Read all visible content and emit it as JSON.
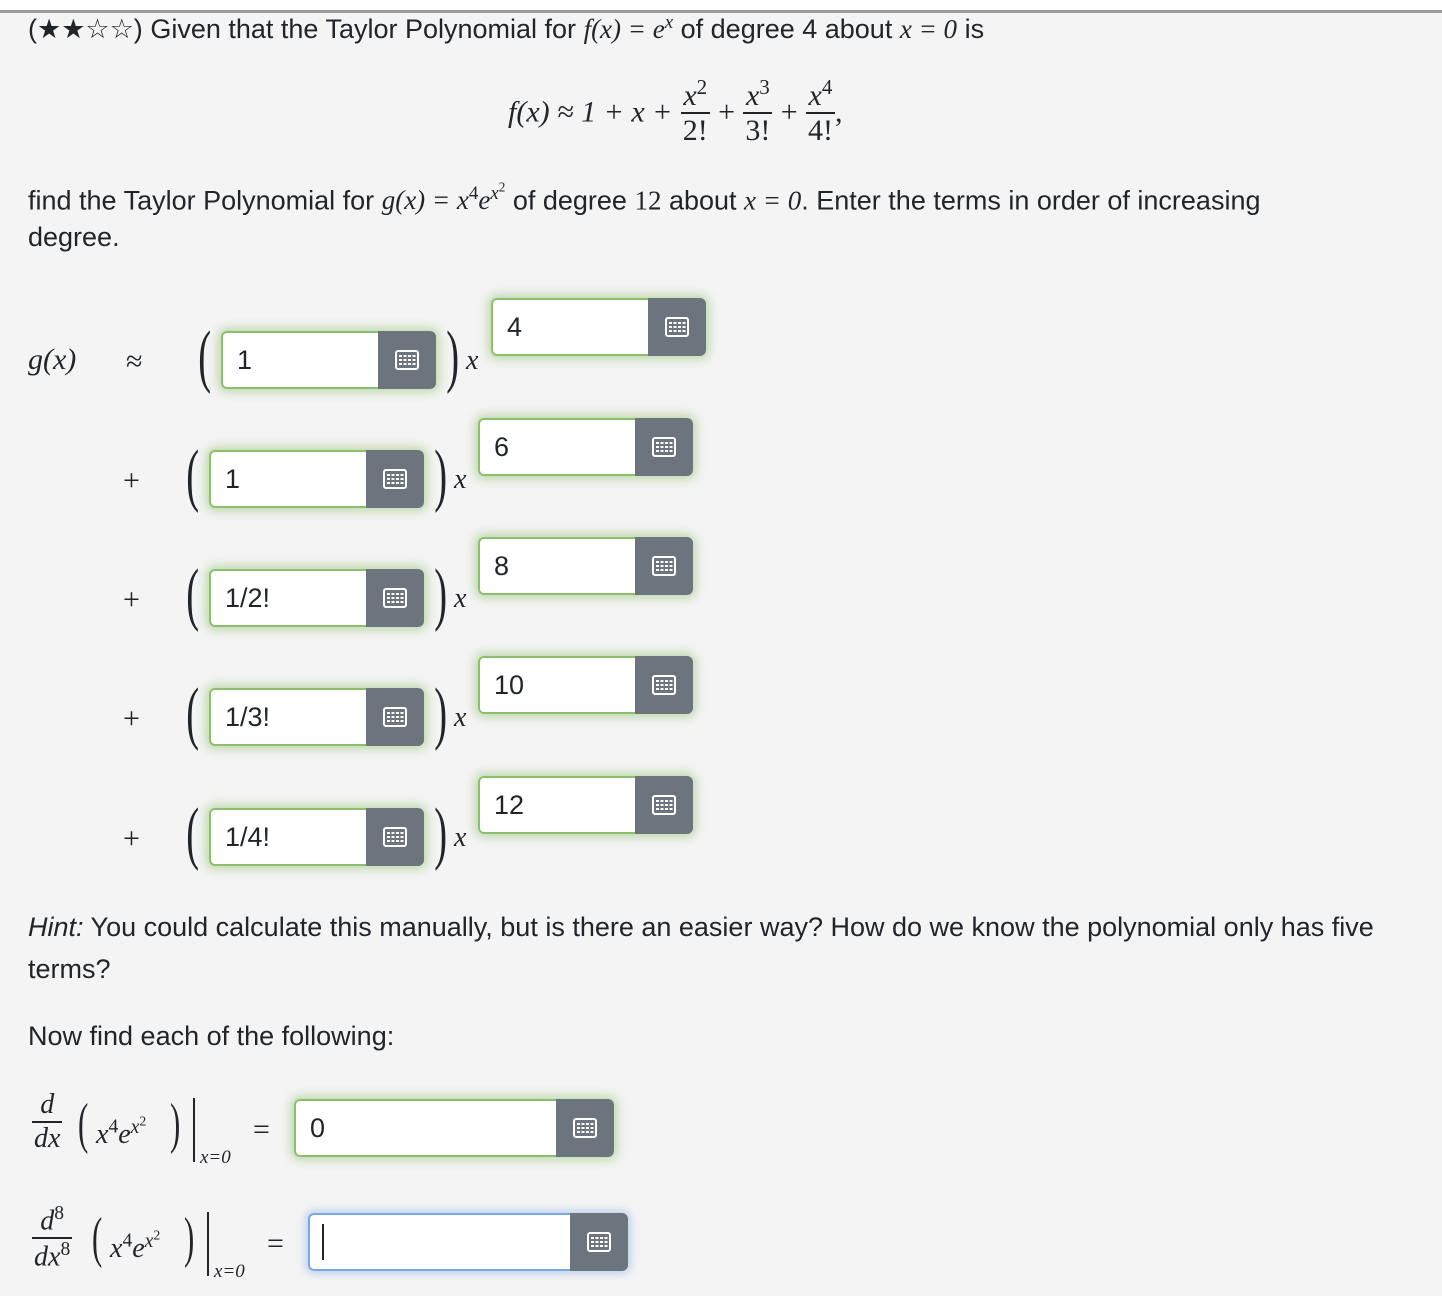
{
  "question": {
    "stars": "(★★☆☆)",
    "intro_text": "Given that the Taylor Polynomial for",
    "f_def": "f(x) = e",
    "f_exp": "x",
    "degree_text": "of degree 4 about",
    "about_eq": "x = 0",
    "is_text": "is",
    "display": {
      "lhs": "f(x) ≈ 1 + x +",
      "t2_num": "x",
      "t2_exp": "2",
      "t2_den": "2!",
      "t3_num": "x",
      "t3_exp": "3",
      "t3_den": "3!",
      "t4_num": "x",
      "t4_exp": "4",
      "t4_den": "4!",
      "plus": "+",
      "comma": ","
    },
    "find_text": "find the Taylor Polynomial for",
    "g_def": "g(x) = x",
    "g_exp1": "4",
    "g_e": "e",
    "g_exp2": "x",
    "g_exp3": "2",
    "degree12_text": "of degree",
    "degree12": "12",
    "about_text": "about",
    "about12_eq": "x = 0",
    "enter_text": ". Enter the terms in order of increasing",
    "enter_text2": "degree."
  },
  "polynomial": {
    "lhs": "g(x)",
    "approx": "≈",
    "plus": "+",
    "x": "x",
    "terms": [
      {
        "coef": "1",
        "power": "4"
      },
      {
        "coef": "1",
        "power": "6"
      },
      {
        "coef": "1/2!",
        "power": "8"
      },
      {
        "coef": "1/3!",
        "power": "10"
      },
      {
        "coef": "1/4!",
        "power": "12"
      }
    ]
  },
  "hint": {
    "label": "Hint:",
    "text": "You could calculate this manually, but is there an easier way? How do we know the polynomial only has five",
    "text2": "terms?"
  },
  "now_find": "Now find each of the following:",
  "derivatives": [
    {
      "num": "d",
      "den": "dx",
      "order": "",
      "value": "0"
    },
    {
      "num": "d",
      "den": "dx",
      "order": "8",
      "value": ""
    }
  ],
  "deriv_expr": {
    "x": "x",
    "exp4": "4",
    "e": "e",
    "ex": "x",
    "ex2": "2",
    "eval": "x=0",
    "eq": "="
  },
  "icon": "matrix-grid-icon"
}
